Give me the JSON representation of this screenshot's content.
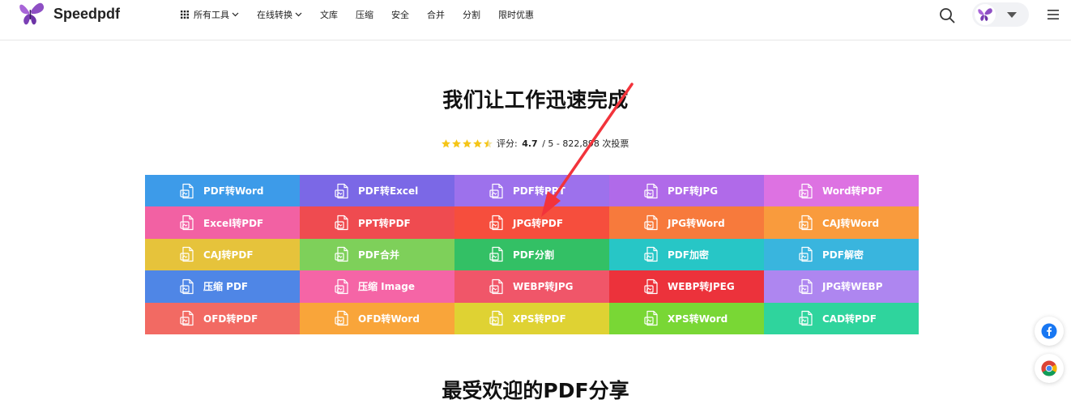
{
  "header": {
    "brand": "Speedpdf",
    "nav": [
      {
        "label": "所有工具",
        "grid": true,
        "dropdown": true
      },
      {
        "label": "在线转换",
        "dropdown": true
      },
      {
        "label": "文库"
      },
      {
        "label": "压缩"
      },
      {
        "label": "安全"
      },
      {
        "label": "合并"
      },
      {
        "label": "分割"
      },
      {
        "label": "限时优惠"
      }
    ],
    "icons": [
      "search-icon",
      "butterfly-avatar-icon",
      "caret-down-icon",
      "hamburger-menu-icon"
    ]
  },
  "hero": {
    "title": "我们让工作迅速完成",
    "rating_prefix": "评分:",
    "rating_value": "4.7",
    "rating_suffix": "/ 5 - 822,898 次投票",
    "stars": 4.5
  },
  "tools": [
    {
      "label": "PDF转Word",
      "color": "#3d9be9",
      "icon": "pdf-to-word-icon"
    },
    {
      "label": "PDF转Excel",
      "color": "#7b68e6",
      "icon": "pdf-to-excel-icon"
    },
    {
      "label": "PDF转PPT",
      "color": "#9d71ec",
      "icon": "pdf-to-ppt-icon"
    },
    {
      "label": "PDF转JPG",
      "color": "#b06ae9",
      "icon": "pdf-to-jpg-icon"
    },
    {
      "label": "Word转PDF",
      "color": "#dd72e2",
      "icon": "word-to-pdf-icon"
    },
    {
      "label": "Excel转PDF",
      "color": "#f261a3",
      "icon": "excel-to-pdf-icon"
    },
    {
      "label": "PPT转PDF",
      "color": "#ef4b50",
      "icon": "ppt-to-pdf-icon"
    },
    {
      "label": "JPG转PDF",
      "color": "#f64e3d",
      "icon": "jpg-to-pdf-icon"
    },
    {
      "label": "JPG转Word",
      "color": "#f77a3c",
      "icon": "jpg-to-word-icon"
    },
    {
      "label": "CAJ转Word",
      "color": "#f99b3d",
      "icon": "caj-to-word-icon"
    },
    {
      "label": "CAJ转PDF",
      "color": "#e6c33b",
      "icon": "caj-to-pdf-icon"
    },
    {
      "label": "PDF合并",
      "color": "#7ed05a",
      "icon": "merge-icon"
    },
    {
      "label": "PDF分割",
      "color": "#33c065",
      "icon": "split-icon"
    },
    {
      "label": "PDF加密",
      "color": "#27c6c6",
      "icon": "lock-icon"
    },
    {
      "label": "PDF解密",
      "color": "#39b5de",
      "icon": "unlock-icon"
    },
    {
      "label": "压缩 PDF",
      "color": "#4f86e6",
      "icon": "compress-pdf-icon"
    },
    {
      "label": "压缩 Image",
      "color": "#f565a6",
      "icon": "compress-image-icon"
    },
    {
      "label": "WEBP转JPG",
      "color": "#f05669",
      "icon": "webp-to-jpg-icon"
    },
    {
      "label": "WEBP转JPEG",
      "color": "#ec323b",
      "icon": "webp-to-jpeg-icon"
    },
    {
      "label": "JPG转WEBP",
      "color": "#ae86f0",
      "icon": "jpg-to-webp-icon"
    },
    {
      "label": "OFD转PDF",
      "color": "#f26a63",
      "icon": "ofd-to-pdf-icon"
    },
    {
      "label": "OFD转Word",
      "color": "#f9a53a",
      "icon": "ofd-to-word-icon"
    },
    {
      "label": "XPS转PDF",
      "color": "#dfd233",
      "icon": "xps-to-pdf-icon"
    },
    {
      "label": "XPS转Word",
      "color": "#79d735",
      "icon": "xps-to-word-icon"
    },
    {
      "label": "CAD转PDF",
      "color": "#2fd49d",
      "icon": "cad-to-pdf-icon"
    }
  ],
  "next_section": {
    "title": "最受欢迎的PDF分享"
  },
  "floating": [
    "facebook-icon",
    "chrome-icon"
  ],
  "colors": {
    "brand_purple": "#8e4fc4",
    "star": "#f5c518",
    "annotation_arrow": "#f2333b"
  }
}
